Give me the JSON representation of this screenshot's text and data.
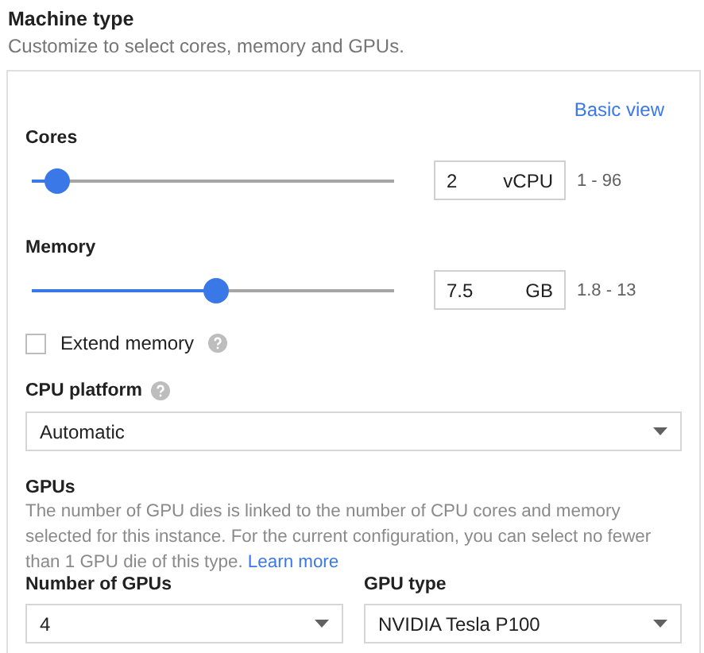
{
  "header": {
    "title": "Machine type",
    "subtitle": "Customize to select cores, memory and GPUs."
  },
  "basic_view_link": "Basic view",
  "cores": {
    "label": "Cores",
    "level": 0.04,
    "value": "2",
    "unit": "vCPU",
    "range": "1 - 96"
  },
  "memory": {
    "label": "Memory",
    "level": 0.51,
    "value": "7.5",
    "unit": "GB",
    "range": "1.8 - 13"
  },
  "extend_memory": {
    "label": "Extend memory",
    "checked": false
  },
  "cpu_platform": {
    "label": "CPU platform",
    "value": "Automatic"
  },
  "gpus": {
    "title": "GPUs",
    "description": "The number of GPU dies is linked to the number of CPU cores and memory selected for this instance. For the current configuration, you can select no fewer than 1 GPU die of this type.",
    "link": "Learn more",
    "fields": [
      {
        "label": "Number of GPUs",
        "value": "4"
      },
      {
        "label": "GPU type",
        "value": "NVIDIA Tesla P100"
      }
    ]
  }
}
